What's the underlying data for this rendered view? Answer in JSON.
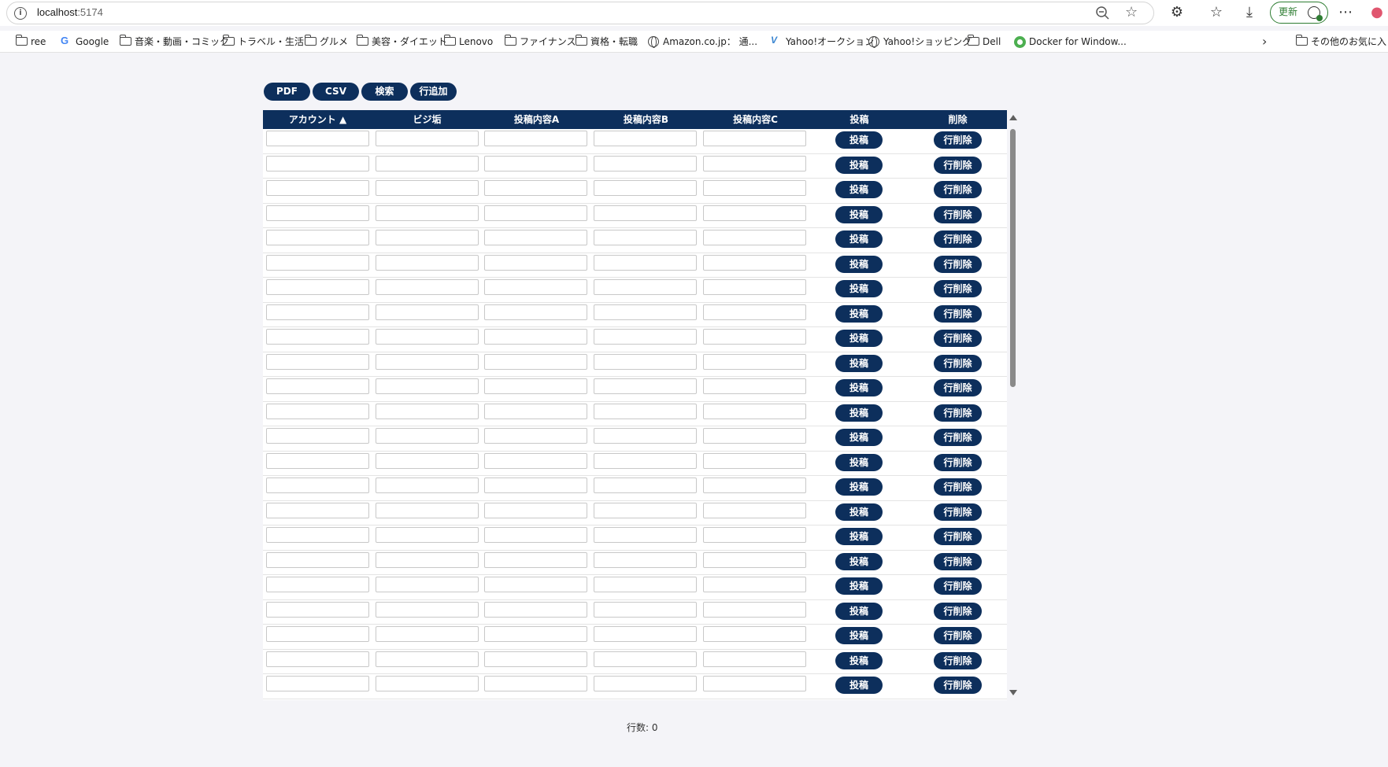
{
  "browser": {
    "url_host": "localhost",
    "url_port": ":5174",
    "update_label": "更新",
    "bookmarks": [
      {
        "label": "ree",
        "icon": "folder-icon"
      },
      {
        "label": "Google",
        "icon": "google-icon"
      },
      {
        "label": "音楽・動画・コミック",
        "icon": "folder-icon"
      },
      {
        "label": "トラベル・生活",
        "icon": "folder-icon"
      },
      {
        "label": "グルメ",
        "icon": "folder-icon"
      },
      {
        "label": "美容・ダイエット",
        "icon": "folder-icon"
      },
      {
        "label": "Lenovo",
        "icon": "folder-icon"
      },
      {
        "label": "ファイナンス",
        "icon": "folder-icon"
      },
      {
        "label": "資格・転職",
        "icon": "folder-icon"
      },
      {
        "label": "Amazon.co.jp： 通...",
        "icon": "globe-icon"
      },
      {
        "label": "Yahoo!オークション",
        "icon": "yahoo-auction-icon"
      },
      {
        "label": "Yahoo!ショッピング",
        "icon": "globe-icon"
      },
      {
        "label": "Dell",
        "icon": "folder-icon"
      },
      {
        "label": "Docker for Window...",
        "icon": "docker-icon"
      }
    ],
    "other_favorites": "その他のお気に入り"
  },
  "actions": {
    "pdf": "PDF",
    "csv": "CSV",
    "search": "検索",
    "add_row": "行追加"
  },
  "table": {
    "headers": [
      "アカウント ▲",
      "ビジ垢",
      "投稿内容A",
      "投稿内容B",
      "投稿内容C",
      "投稿",
      "削除"
    ],
    "visible_rows": 23,
    "post_button": "投稿",
    "delete_button": "行削除"
  },
  "footer": {
    "row_count": "行数: 0"
  },
  "colors": {
    "accent": "#0d2f5c",
    "page_bg": "#f4f4f8"
  }
}
